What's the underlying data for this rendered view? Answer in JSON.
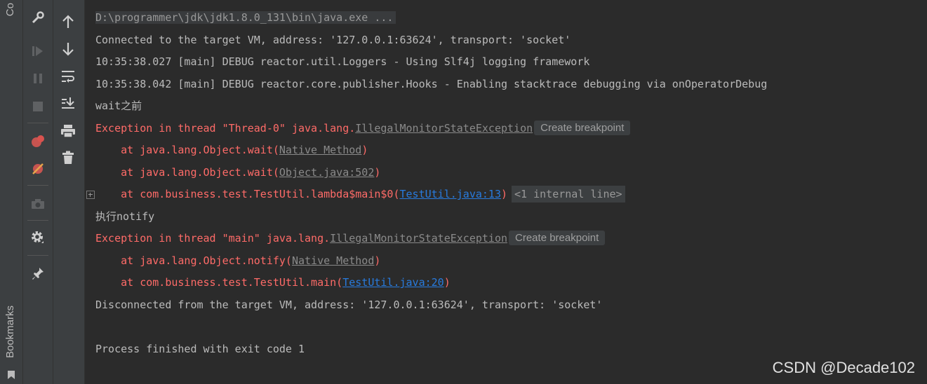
{
  "left_stripe": {
    "top_label": "Co",
    "bottom_label": "Bookmarks"
  },
  "toolbar_left": {
    "icons": [
      "wrench-icon",
      "resume-icon",
      "pause-icon",
      "stop-icon",
      "view-breakpoints-icon",
      "mute-breakpoints-icon",
      "camera-icon",
      "settings-icon",
      "pin-icon"
    ]
  },
  "toolbar_right": {
    "icons": [
      "up-arrow-icon",
      "down-arrow-icon",
      "soft-wrap-icon",
      "scroll-to-end-icon",
      "print-icon",
      "trash-icon"
    ]
  },
  "console": {
    "command": "D:\\programmer\\jdk\\jdk1.8.0_131\\bin\\java.exe ...",
    "connected": "Connected to the target VM, address: '127.0.0.1:63624', transport: 'socket'",
    "log1": "10:35:38.027 [main] DEBUG reactor.util.Loggers - Using Slf4j logging framework",
    "log2": "10:35:38.042 [main] DEBUG reactor.core.publisher.Hooks - Enabling stacktrace debugging via onOperatorDebug",
    "wait_before": "wait之前",
    "exc1_prefix": "Exception in thread \"Thread-0\" java.lang.",
    "exc1_class": "IllegalMonitorStateException",
    "create_breakpoint": "Create breakpoint",
    "exc1_at1_prefix": "    at java.lang.Object.wait(",
    "exc1_at1_link": "Native Method",
    "exc1_at2_prefix": "    at java.lang.Object.wait(",
    "exc1_at2_link": "Object.java:502",
    "exc1_at3_prefix": "    at com.business.test.TestUtil.lambda$main$0(",
    "exc1_at3_link": "TestUtil.java:13",
    "close_paren": ")",
    "internal_line": "<1 internal line>",
    "exec_notify": "执行notify",
    "exc2_prefix": "Exception in thread \"main\" java.lang.",
    "exc2_class": "IllegalMonitorStateException",
    "exc2_at1_prefix": "    at java.lang.Object.notify(",
    "exc2_at1_link": "Native Method",
    "exc2_at2_prefix": "    at com.business.test.TestUtil.main(",
    "exc2_at2_link": "TestUtil.java:20",
    "disconnected": "Disconnected from the target VM, address: '127.0.0.1:63624', transport: 'socket'",
    "process_finished": "Process finished with exit code 1"
  },
  "watermark": "CSDN @Decade102",
  "colors": {
    "error": "#ff6b68",
    "link": "#287bde",
    "text": "#bbbbbb",
    "background": "#2b2b2b"
  }
}
